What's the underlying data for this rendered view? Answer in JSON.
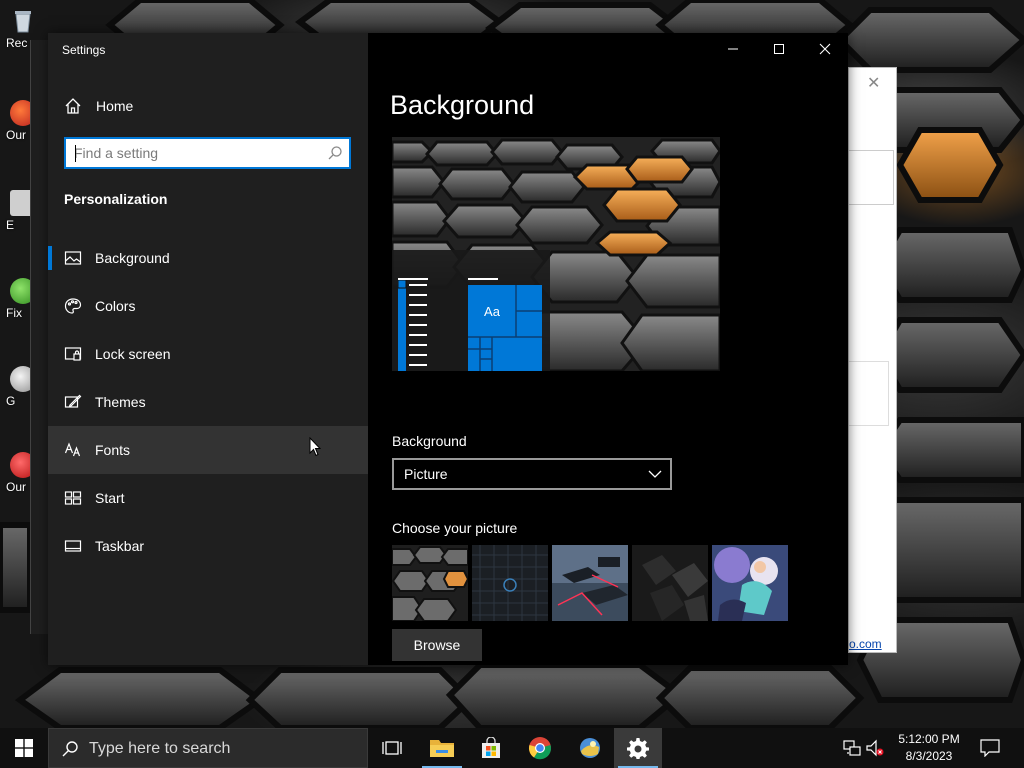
{
  "desktop": {
    "icons": [
      {
        "label": "Rec",
        "icon": "recycle-bin-icon"
      },
      {
        "label": "Our",
        "icon": "app-shortcut-icon"
      },
      {
        "label": "E",
        "icon": "app-shortcut-icon"
      },
      {
        "label": "Fix",
        "icon": "app-shortcut-icon"
      },
      {
        "label": "G",
        "icon": "app-shortcut-icon"
      },
      {
        "label": "Our",
        "icon": "app-shortcut-icon"
      }
    ]
  },
  "behind_window": {
    "link_text": "o.com"
  },
  "settings": {
    "title": "Settings",
    "home_label": "Home",
    "search_placeholder": "Find a setting",
    "section_title": "Personalization",
    "nav_items": [
      {
        "label": "Background",
        "icon": "picture-icon",
        "active": true
      },
      {
        "label": "Colors",
        "icon": "palette-icon"
      },
      {
        "label": "Lock screen",
        "icon": "lock-screen-icon"
      },
      {
        "label": "Themes",
        "icon": "themes-icon"
      },
      {
        "label": "Fonts",
        "icon": "fonts-icon",
        "hover": true
      },
      {
        "label": "Start",
        "icon": "start-icon"
      },
      {
        "label": "Taskbar",
        "icon": "taskbar-icon"
      }
    ],
    "page_title": "Background",
    "preview_tile_text": "Aa",
    "background_label": "Background",
    "background_value": "Picture",
    "choose_picture_label": "Choose your picture",
    "browse_label": "Browse",
    "accent_color": "#0078d7"
  },
  "taskbar": {
    "search_placeholder": "Type here to search",
    "apps": [
      {
        "name": "task-view",
        "icon": "task-view-icon"
      },
      {
        "name": "file-explorer",
        "icon": "folder-icon"
      },
      {
        "name": "microsoft-store",
        "icon": "store-icon"
      },
      {
        "name": "chrome",
        "icon": "chrome-icon"
      },
      {
        "name": "photo-app",
        "icon": "photo-app-icon"
      },
      {
        "name": "settings",
        "icon": "gear-icon"
      }
    ],
    "time": "5:12:00 PM",
    "date": "8/3/2023"
  }
}
